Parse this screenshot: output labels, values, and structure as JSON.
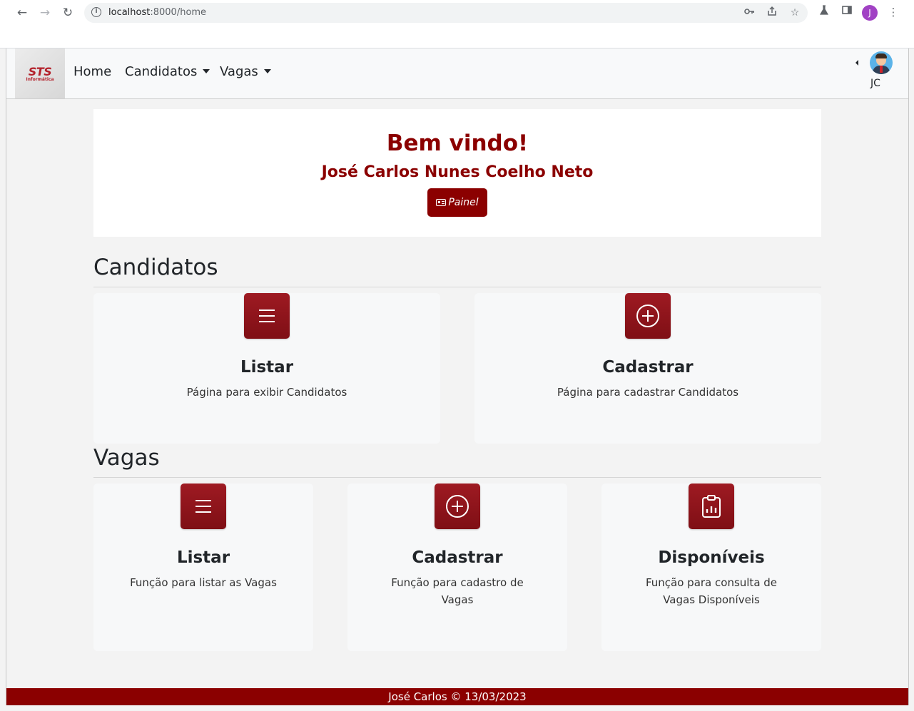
{
  "browser": {
    "url_host": "localhost",
    "url_path": ":8000/home",
    "profile_initial": "J"
  },
  "navbar": {
    "logo_text": "STS",
    "logo_sub": "Informática",
    "links": [
      {
        "label": "Home"
      },
      {
        "label": "Candidatos"
      },
      {
        "label": "Vagas"
      }
    ],
    "user_initials": "JC"
  },
  "welcome": {
    "title": "Bem vindo!",
    "name": "José Carlos Nunes Coelho Neto",
    "panel_button": "Painel"
  },
  "sections": {
    "candidatos": {
      "title": "Candidatos",
      "cards": [
        {
          "title": "Listar",
          "desc": "Página para exibir Candidatos",
          "icon": "list-icon"
        },
        {
          "title": "Cadastrar",
          "desc": "Página para cadastrar Candidatos",
          "icon": "plus-circle-icon"
        }
      ]
    },
    "vagas": {
      "title": "Vagas",
      "cards": [
        {
          "title": "Listar",
          "desc_lines": [
            "Função para listar as Vagas"
          ],
          "icon": "list-icon"
        },
        {
          "title": "Cadastrar",
          "desc_lines": [
            "Função para cadastro de",
            "Vagas"
          ],
          "icon": "plus-circle-icon"
        },
        {
          "title": "Disponíveis",
          "desc_lines": [
            "Função para consulta de",
            "Vagas Disponíveis"
          ],
          "icon": "clipboard-chart-icon"
        }
      ]
    }
  },
  "footer": {
    "text": "José Carlos © 13/03/2023"
  },
  "colors": {
    "brand": "#8b0000",
    "navbar_bg": "#f8f9fa",
    "card_bg": "#f7f8f9"
  }
}
